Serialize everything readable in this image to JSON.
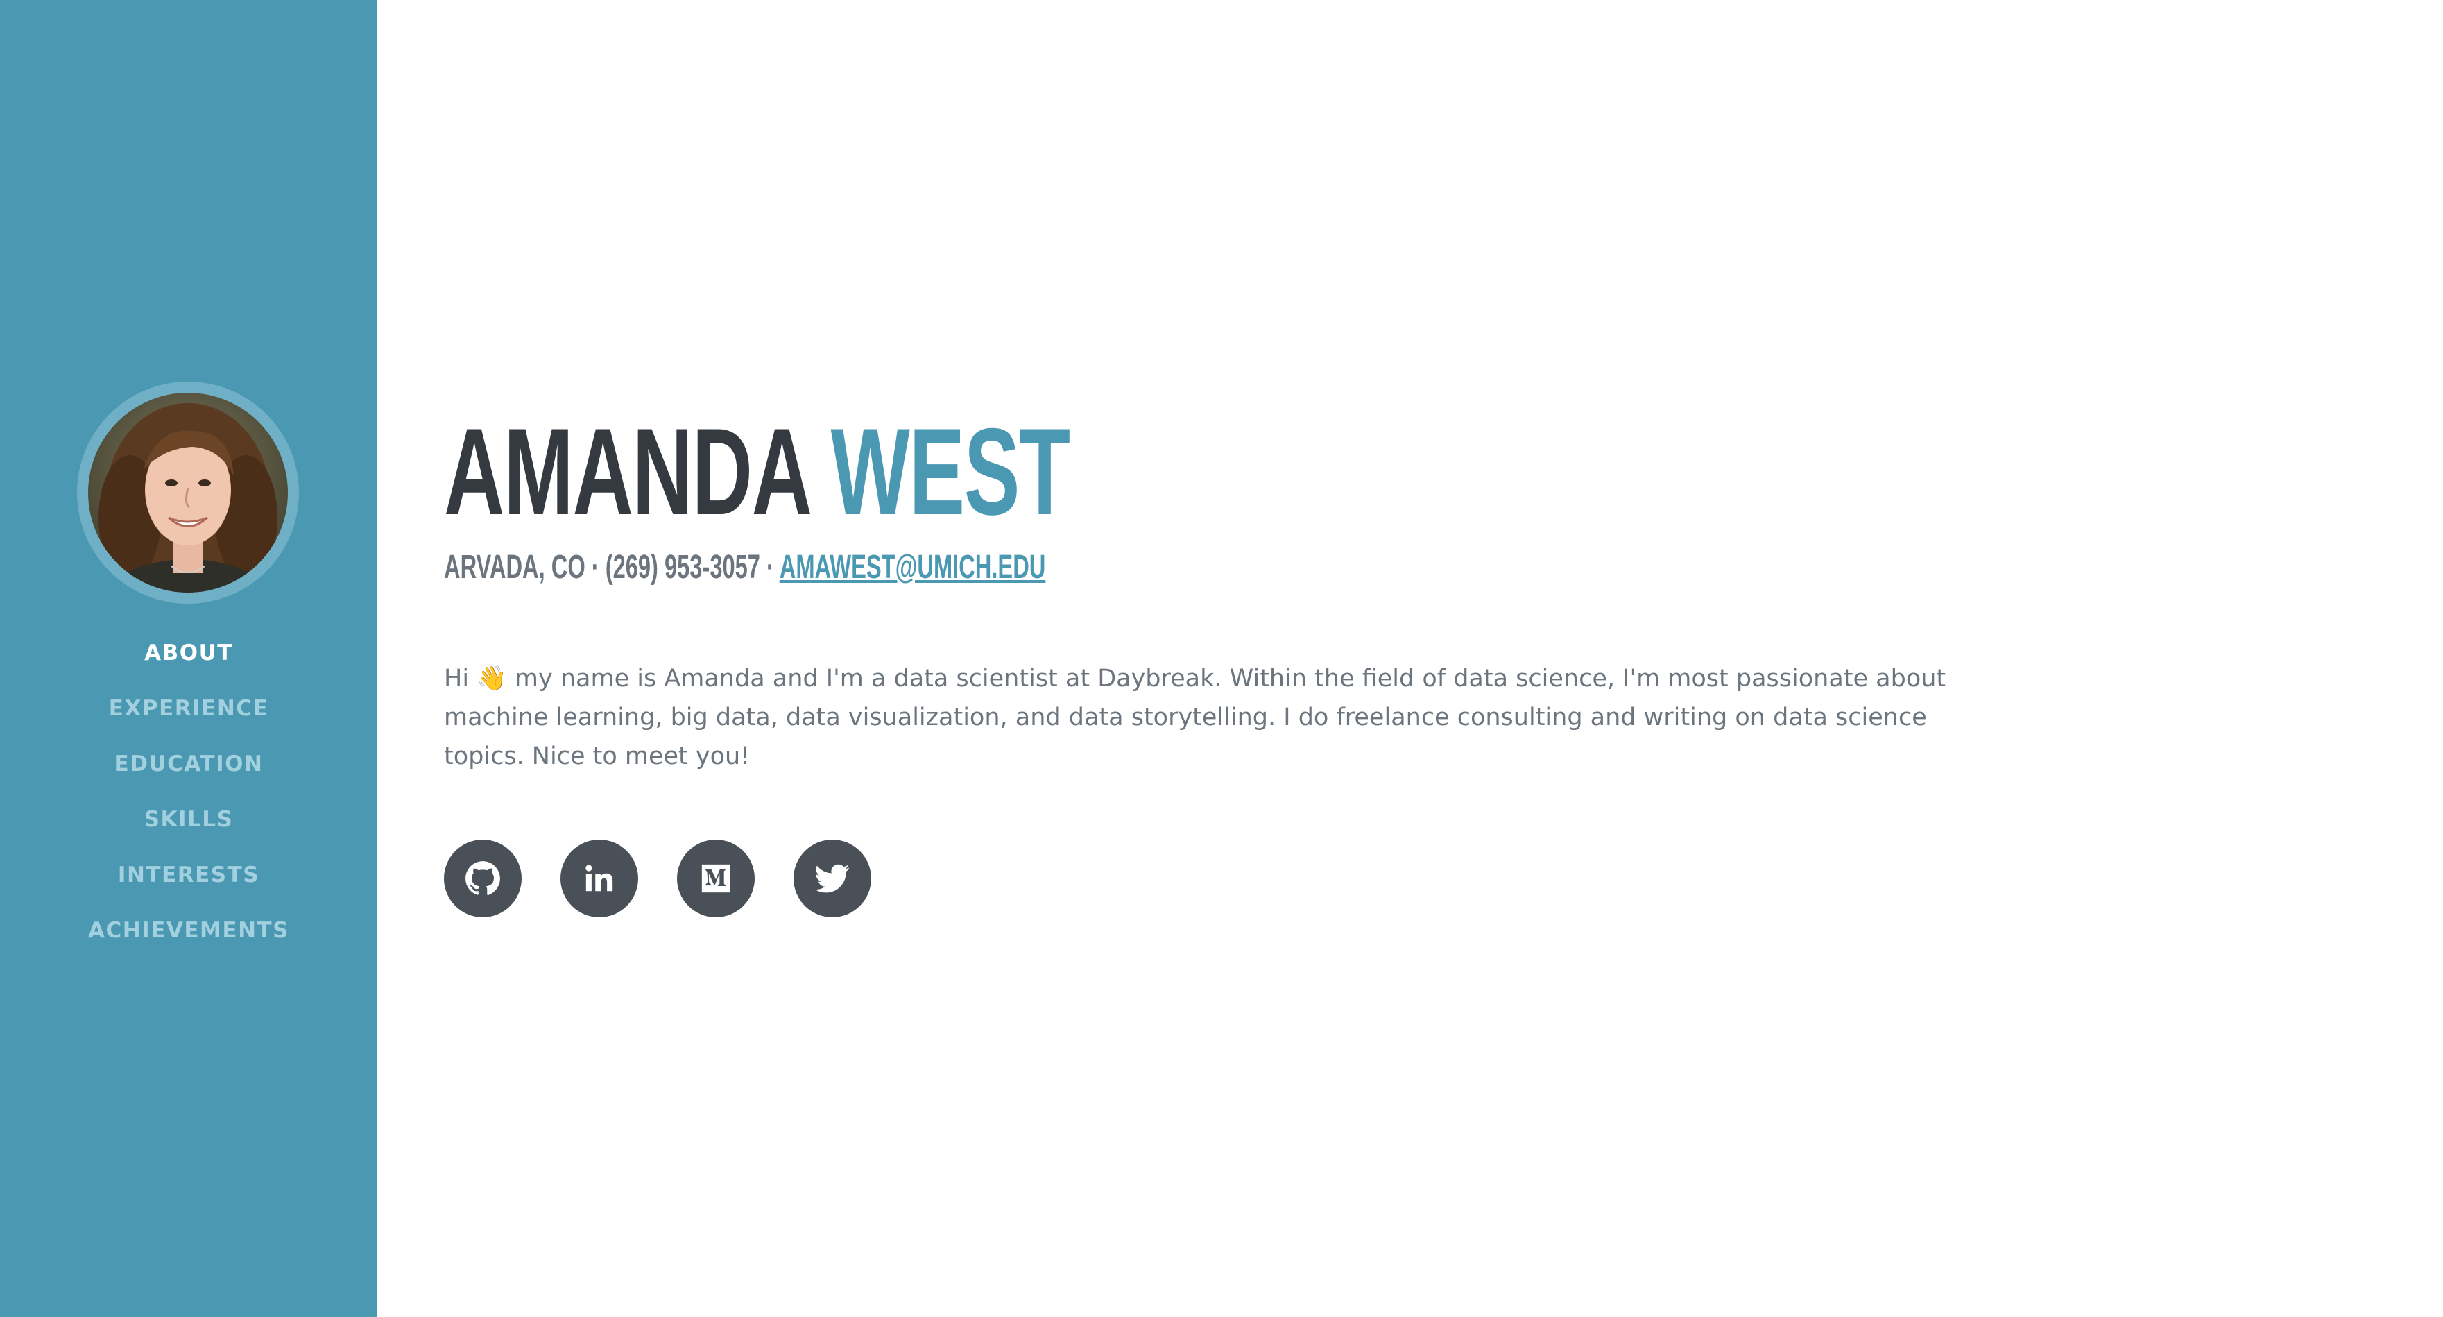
{
  "sidebar": {
    "background_color": "#4b98b2",
    "avatar_alt": "profile-photo",
    "nav": [
      {
        "label": "ABOUT",
        "active": true
      },
      {
        "label": "EXPERIENCE",
        "active": false
      },
      {
        "label": "EDUCATION",
        "active": false
      },
      {
        "label": "SKILLS",
        "active": false
      },
      {
        "label": "INTERESTS",
        "active": false
      },
      {
        "label": "ACHIEVEMENTS",
        "active": false
      }
    ]
  },
  "header": {
    "first_name": "AMANDA",
    "last_name": "WEST",
    "location": "ARVADA, CO",
    "separator": "·",
    "phone": "(269) 953-3057",
    "email": "AMAWEST@UMICH.EDU"
  },
  "about": {
    "greeting": "Hi",
    "wave_emoji": "👋",
    "text": "my name is Amanda and I'm a data scientist at Daybreak. Within the field of data science, I'm most passionate about machine learning, big data, data visualization, and data storytelling. I do freelance consulting and writing on data science topics. Nice to meet you!"
  },
  "socials": [
    {
      "name": "github-icon"
    },
    {
      "name": "linkedin-icon"
    },
    {
      "name": "medium-icon"
    },
    {
      "name": "twitter-icon"
    }
  ],
  "colors": {
    "accent": "#4b98b2",
    "heading_dark": "#343a40",
    "body_text": "#6c757d",
    "social_bg": "#495057",
    "nav_inactive": "#a3d0df"
  }
}
